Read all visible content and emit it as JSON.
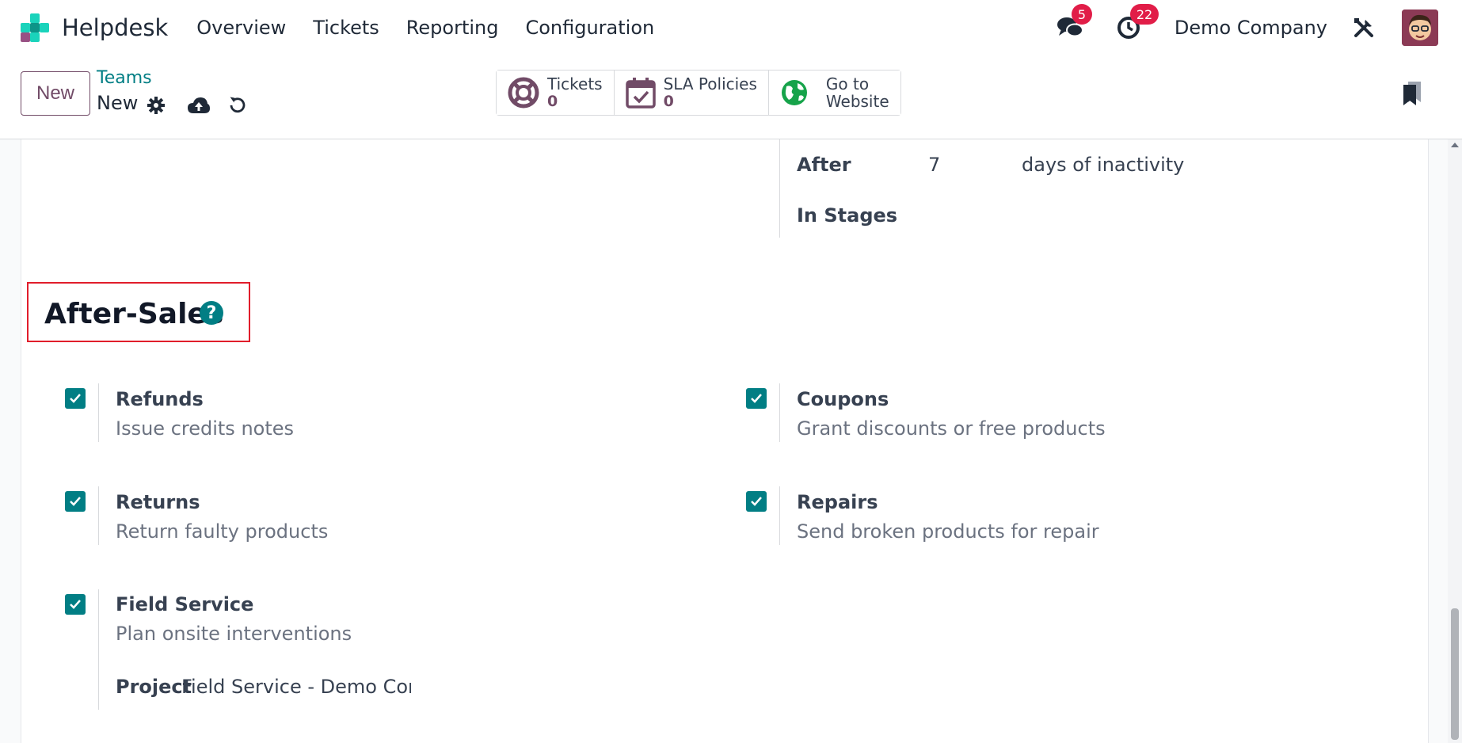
{
  "navbar": {
    "app_name": "Helpdesk",
    "menu": [
      "Overview",
      "Tickets",
      "Reporting",
      "Configuration"
    ],
    "messages_count": "5",
    "activities_count": "22",
    "company": "Demo Company"
  },
  "control": {
    "new_label": "New",
    "breadcrumb": "Teams",
    "record_name": "New",
    "smart_buttons": {
      "tickets": {
        "label": "Tickets",
        "value": "0"
      },
      "sla": {
        "label": "SLA Policies",
        "value": "0"
      },
      "website": {
        "line1": "Go to",
        "line2": "Website"
      }
    }
  },
  "auto_close": {
    "after_label": "After",
    "after_value": "7",
    "after_unit": "days of inactivity",
    "stages_label": "In Stages"
  },
  "section": {
    "title": "After-Sales",
    "help": "?"
  },
  "settings": {
    "refunds": {
      "title": "Refunds",
      "desc": "Issue credits notes",
      "checked": true
    },
    "coupons": {
      "title": "Coupons",
      "desc": "Grant discounts or free products",
      "checked": true
    },
    "returns": {
      "title": "Returns",
      "desc": "Return faulty products",
      "checked": true
    },
    "repairs": {
      "title": "Repairs",
      "desc": "Send broken products for repair",
      "checked": true
    },
    "field_service": {
      "title": "Field Service",
      "desc": "Plan onsite interventions",
      "checked": true,
      "project_label": "Project",
      "project_value": "Field Service - Demo Comp"
    }
  },
  "colors": {
    "brand_purple": "#714b67",
    "teal": "#017e84",
    "badge_red": "#e11d48",
    "highlight_red": "#e11d2b"
  }
}
